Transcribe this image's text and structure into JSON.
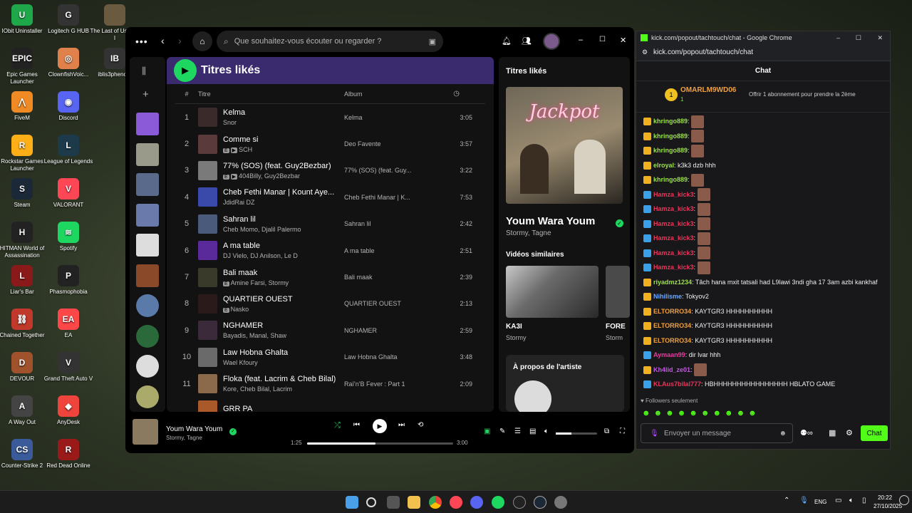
{
  "desktop": {
    "icons": [
      {
        "label": "IObit Uninstaller",
        "abbr": "U",
        "color": "#1fa84a"
      },
      {
        "label": "Logitech G HUB",
        "abbr": "G",
        "color": "#333"
      },
      {
        "label": "The Last of Us Part I",
        "abbr": "",
        "color": "#6a5a40"
      },
      {
        "label": "Epic Games Launcher",
        "abbr": "EPIC",
        "color": "#222"
      },
      {
        "label": "ClownfishVoic...",
        "abbr": "◎",
        "color": "#e0804a"
      },
      {
        "label": "iblis3phenom",
        "abbr": "IB",
        "color": "#333"
      },
      {
        "label": "FiveM",
        "abbr": "⋀",
        "color": "#f08a24"
      },
      {
        "label": "Discord",
        "abbr": "◉",
        "color": "#5865f2"
      },
      {
        "label": "Rockstar Games Launcher",
        "abbr": "R",
        "color": "#fcaf17"
      },
      {
        "label": "League of Legends",
        "abbr": "L",
        "color": "#1c3a4a"
      },
      {
        "label": "Steam",
        "abbr": "S",
        "color": "#1b2838"
      },
      {
        "label": "VALORANT",
        "abbr": "V",
        "color": "#ff4655"
      },
      {
        "label": "HITMAN World of Assassination",
        "abbr": "H",
        "color": "#222"
      },
      {
        "label": "Spotify",
        "abbr": "≋",
        "color": "#1ed760"
      },
      {
        "label": "Liar's Bar",
        "abbr": "L",
        "color": "#8a1a1a"
      },
      {
        "label": "Phasmophobia",
        "abbr": "P",
        "color": "#222"
      },
      {
        "label": "Chained Together",
        "abbr": "⛓",
        "color": "#c0392b"
      },
      {
        "label": "EA",
        "abbr": "EA",
        "color": "#ff4747"
      },
      {
        "label": "DEVOUR",
        "abbr": "D",
        "color": "#a0522d"
      },
      {
        "label": "Grand Theft Auto V",
        "abbr": "V",
        "color": "#333"
      },
      {
        "label": "A Way Out",
        "abbr": "A",
        "color": "#444"
      },
      {
        "label": "AnyDesk",
        "abbr": "◆",
        "color": "#ef443b"
      },
      {
        "label": "Counter-Strike 2",
        "abbr": "CS",
        "color": "#3a5a9a"
      },
      {
        "label": "Red Dead Online",
        "abbr": "R",
        "color": "#9a1a1a"
      }
    ]
  },
  "spotify": {
    "search_placeholder": "Que souhaitez-vous écouter ou regarder ?",
    "playlist_title": "Titres likés",
    "col_num": "#",
    "col_title": "Titre",
    "col_album": "Album",
    "tracks": [
      {
        "n": "1",
        "title": "Kelma",
        "artist": "Snor",
        "album": "Kelma",
        "dur": "3:05",
        "e": false,
        "v": false,
        "c": "#3a2a2a"
      },
      {
        "n": "2",
        "title": "Comme si",
        "artist": "SCH",
        "album": "Deo Favente",
        "dur": "3:57",
        "e": true,
        "v": true,
        "c": "#5a3a3a"
      },
      {
        "n": "3",
        "title": "77% (SOS) (feat. Guy2Bezbar)",
        "artist": "404Billy, Guy2Bezbar",
        "album": "77% (SOS) (feat. Guy...",
        "dur": "3:22",
        "e": true,
        "v": true,
        "c": "#7a7a7a"
      },
      {
        "n": "4",
        "title": "Cheb Fethi Manar | Kount Aye...",
        "artist": "JdidRai DZ",
        "album": "Cheb Fethi Manar | K...",
        "dur": "7:53",
        "e": false,
        "v": false,
        "c": "#3a4aaa"
      },
      {
        "n": "5",
        "title": "Sahran lil",
        "artist": "Cheb Momo, Djalil Palermo",
        "album": "Sahran lil",
        "dur": "2:42",
        "e": false,
        "v": false,
        "c": "#4a5a7a"
      },
      {
        "n": "6",
        "title": "A ma table",
        "artist": "DJ Vielo, DJ Anilson, Le D",
        "album": "A ma table",
        "dur": "2:51",
        "e": false,
        "v": false,
        "c": "#5a2a9a"
      },
      {
        "n": "7",
        "title": "Bali maak",
        "artist": "Amine Farsi, Stormy",
        "album": "Bali maak",
        "dur": "2:39",
        "e": true,
        "v": false,
        "c": "#3a3a2a"
      },
      {
        "n": "8",
        "title": "QUARTIER OUEST",
        "artist": "Nasko",
        "album": "QUARTIER OUEST",
        "dur": "2:13",
        "e": true,
        "v": false,
        "c": "#2a1a1a"
      },
      {
        "n": "9",
        "title": "NGHAMER",
        "artist": "Bayadis, Manal, Shaw",
        "album": "NGHAMER",
        "dur": "2:59",
        "e": false,
        "v": false,
        "c": "#3a2a3a"
      },
      {
        "n": "10",
        "title": "Law Hobna Ghalta",
        "artist": "Wael Kfoury",
        "album": "Law Hobna Ghalta",
        "dur": "3:48",
        "e": false,
        "v": false,
        "c": "#6a6a6a"
      },
      {
        "n": "11",
        "title": "Floka (feat. Lacrim & Cheb Bilal)",
        "artist": "Kore, Cheb Bilal, Lacrim",
        "album": "Raï'n'B Fever : Part 1",
        "dur": "2:09",
        "e": false,
        "v": false,
        "c": "#8a6a4a"
      },
      {
        "n": "",
        "title": "GRR PA",
        "artist": "",
        "album": "",
        "dur": "",
        "e": false,
        "v": false,
        "c": "#aa5a2a"
      }
    ],
    "right_panel": {
      "header": "Titres likés",
      "cover_text": "Jackpot",
      "song": "Youm Wara Youm",
      "artists": "Stormy, Tagne",
      "similar_title": "Vidéos similaires",
      "similar": [
        {
          "title": "KA3I",
          "artist": "Stormy"
        },
        {
          "title": "FORE",
          "artist": "Storm"
        }
      ],
      "about": "À propos de l'artiste"
    },
    "player": {
      "song": "Youm Wara Youm",
      "artists": "Stormy, Tagne",
      "elapsed": "1:25",
      "total": "3:00",
      "progress": 0.47
    }
  },
  "chrome": {
    "title": "kick.com/popout/tachtouch/chat - Google Chrome",
    "url": "kick.com/popout/tachtouch/chat",
    "chat_title": "Chat",
    "top_user": "OMARLM9WD06",
    "top_count": "1",
    "gift_text": "Offrir 1 abonnement pour prendre la 2ème",
    "messages": [
      {
        "user": "khringo889",
        "color": "#9be04a",
        "text": "",
        "img": true
      },
      {
        "user": "khringo889",
        "color": "#9be04a",
        "text": "",
        "img": true
      },
      {
        "user": "khringo889",
        "color": "#9be04a",
        "text": "",
        "img": true
      },
      {
        "user": "elroyal",
        "color": "#9be04a",
        "text": "k3k3 dzb hhh",
        "img": false
      },
      {
        "user": "khringo889",
        "color": "#9be04a",
        "text": "",
        "img": true
      },
      {
        "user": "Hamza_kick3",
        "color": "#e8365a",
        "text": "",
        "img": true
      },
      {
        "user": "Hamza_kick3",
        "color": "#e8365a",
        "text": "",
        "img": true
      },
      {
        "user": "Hamza_kick3",
        "color": "#e8365a",
        "text": "",
        "img": true
      },
      {
        "user": "Hamza_kick3",
        "color": "#e8365a",
        "text": "",
        "img": true
      },
      {
        "user": "Hamza_kick3",
        "color": "#e8365a",
        "text": "",
        "img": true
      },
      {
        "user": "Hamza_kick3",
        "color": "#e8365a",
        "text": "",
        "img": true
      },
      {
        "user": "riyadmz1234",
        "color": "#9be04a",
        "text": "Tâch hana mxit tatsali had L9lawi 3ndi gha 17 3am azbi kankhaf",
        "img": false
      },
      {
        "user": "Nihilisme",
        "color": "#6aa8ff",
        "text": "Tokyov2",
        "img": false
      },
      {
        "user": "ELTORRO34",
        "color": "#f0a040",
        "text": "KAYTGR3 HHHHHHHHHH",
        "img": false
      },
      {
        "user": "ELTORRO34",
        "color": "#f0a040",
        "text": "KAYTGR3 HHHHHHHHHH",
        "img": false
      },
      {
        "user": "ELTORRO34",
        "color": "#f0a040",
        "text": "KAYTGR3 HHHHHHHHHH",
        "img": false
      },
      {
        "user": "Aymaan99",
        "color": "#e83aa0",
        "text": "dir lvar hhh",
        "img": false
      },
      {
        "user": "Kh4lid_ze01",
        "color": "#c05ae0",
        "text": "",
        "img": true
      },
      {
        "user": "KLAus7bilal777",
        "color": "#e8365a",
        "text": "HBHHHHHHHHHHHHHHHH HBLATO GAME",
        "img": false
      }
    ],
    "followers_only": "Followers seulement",
    "input_placeholder": "Envoyer un message",
    "send_label": "Chat"
  },
  "taskbar": {
    "lang": "ENG",
    "time": "20:22",
    "date": "27/10/2025"
  }
}
